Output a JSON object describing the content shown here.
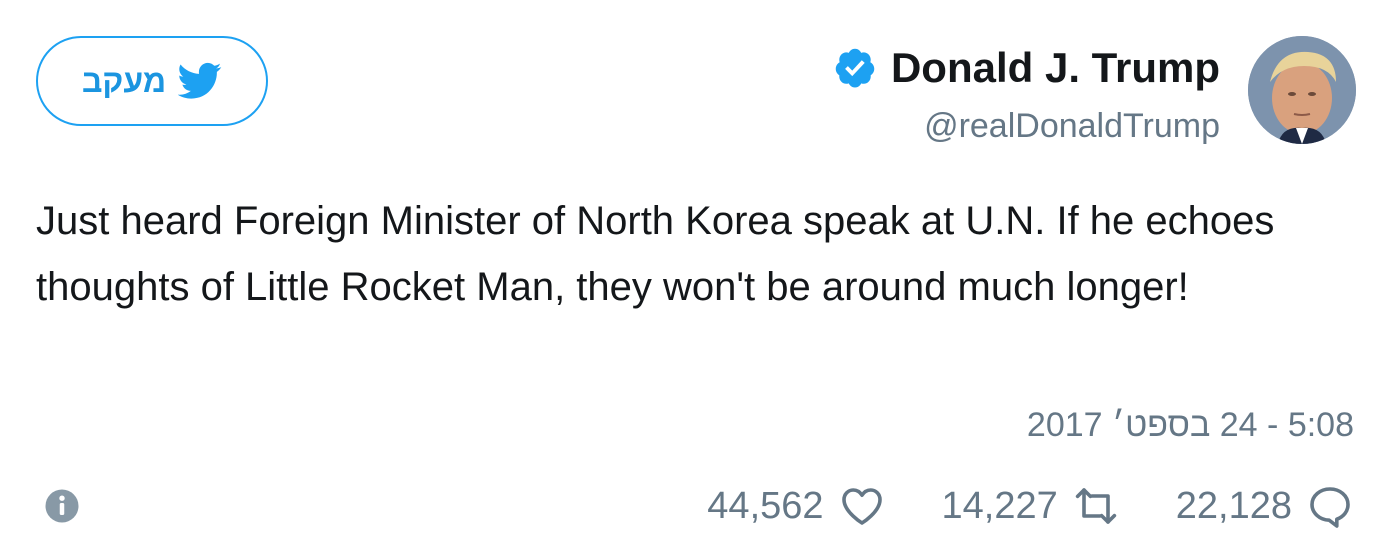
{
  "follow_button": {
    "label": "מעקב",
    "icon": "twitter-bird-icon"
  },
  "author": {
    "name": "Donald J. Trump",
    "handle": "@realDonaldTrump",
    "verified_icon": "verified-badge-icon"
  },
  "tweet": {
    "text": "Just heard Foreign Minister of North Korea speak at U.N. If he echoes thoughts of Little Rocket Man, they won't be around much longer!",
    "timestamp": "5:08 - 24 בספט׳ 2017"
  },
  "actions": {
    "replies": "22,128",
    "retweets": "14,227",
    "likes": "44,562"
  },
  "colors": {
    "accent": "#1da1f2",
    "muted": "#657786",
    "text": "#14171a"
  }
}
